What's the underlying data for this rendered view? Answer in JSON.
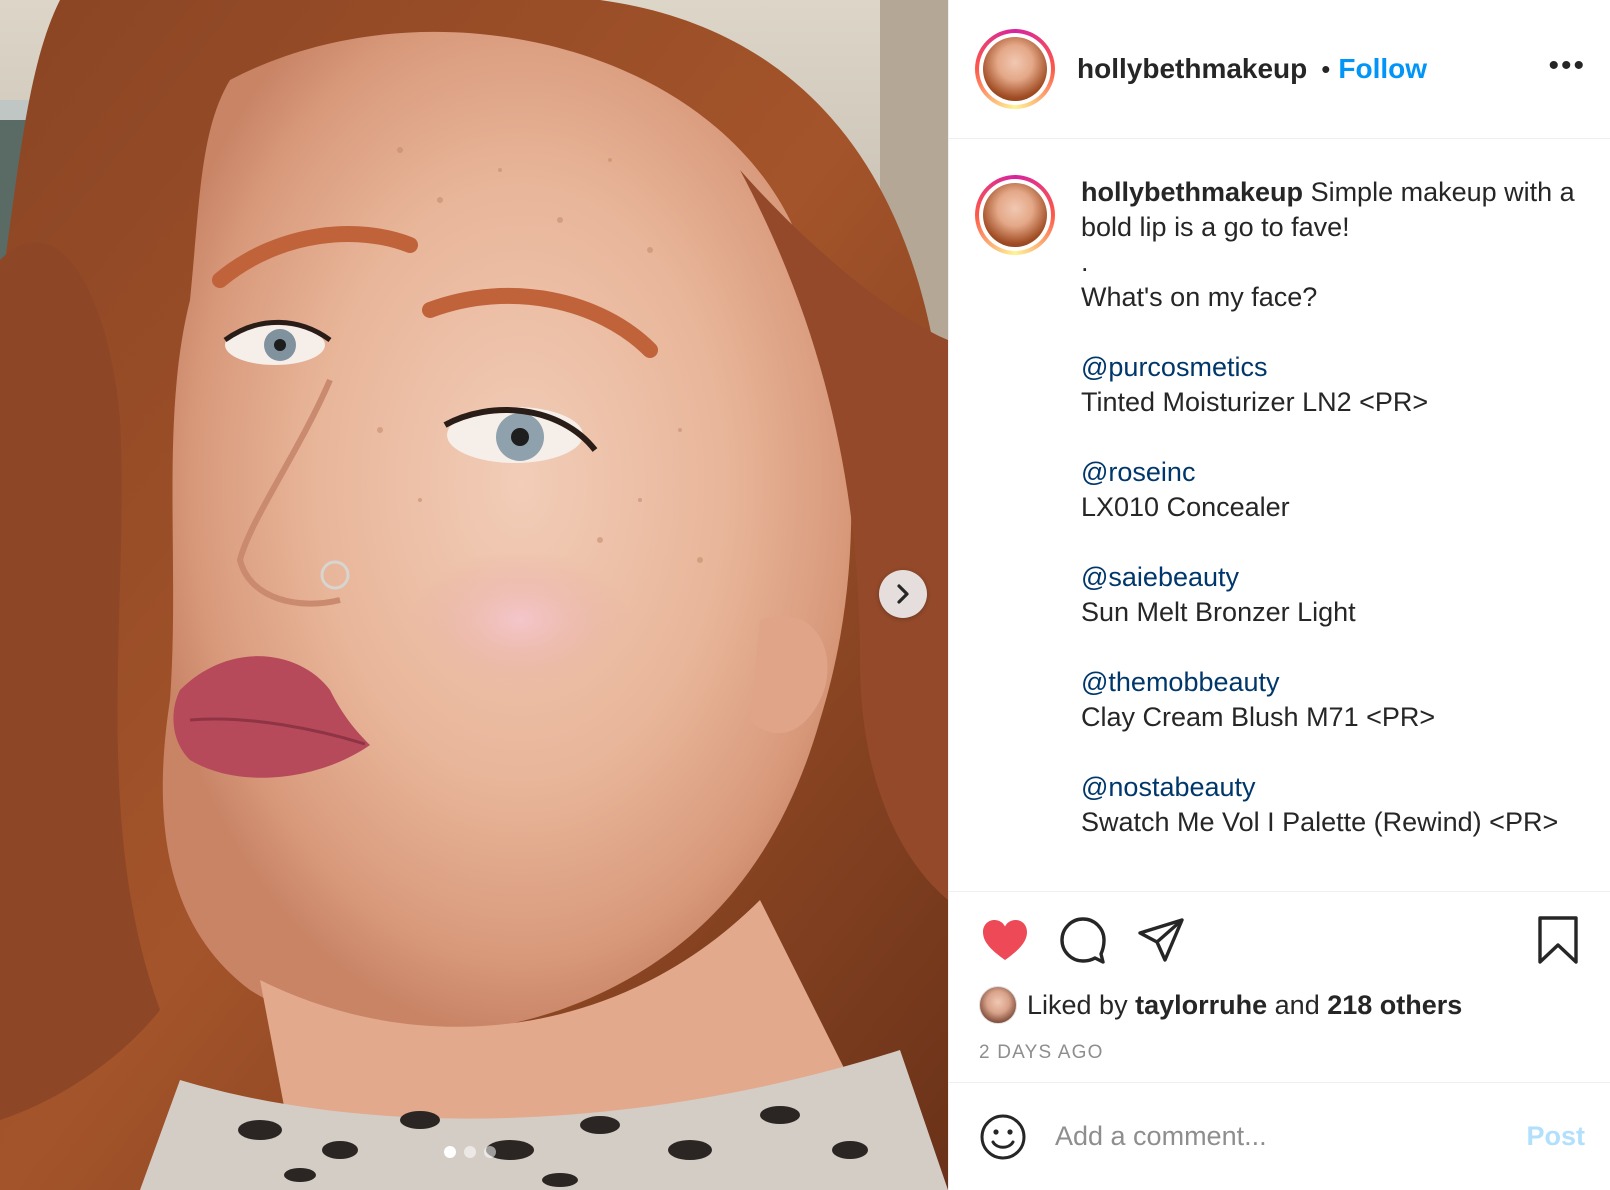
{
  "post": {
    "media": {
      "slide_count": 3,
      "active_slide": 1,
      "next_icon": "chevron-right-icon"
    },
    "header": {
      "username": "hollybethmakeup",
      "separator": "•",
      "follow_label": "Follow",
      "more_label": "•••"
    },
    "caption": {
      "username": "hollybethmakeup",
      "text": "Simple makeup with a bold lip is a go to fave!",
      "dot": ".",
      "question": "What's on my face?",
      "products": [
        {
          "mention": "@purcosmetics",
          "item": "Tinted Moisturizer LN2 <PR>"
        },
        {
          "mention": "@roseinc",
          "item": "LX010 Concealer"
        },
        {
          "mention": "@saiebeauty",
          "item": "Sun Melt Bronzer Light"
        },
        {
          "mention": "@themobbeauty",
          "item": "Clay Cream Blush M71 <PR>"
        },
        {
          "mention": "@nostabeauty",
          "item": "Swatch Me Vol I Palette (Rewind) <PR>"
        }
      ]
    },
    "actions": {
      "liked": true,
      "like_color": "#ed4956",
      "likes_prefix": "Liked by",
      "liked_by_user": "taylorruhe",
      "likes_and": "and",
      "likes_others": "218 others",
      "timestamp": "2 DAYS AGO"
    },
    "comment": {
      "placeholder": "Add a comment...",
      "post_label": "Post"
    },
    "colors": {
      "follow": "#0095f6",
      "mention": "#00376b",
      "post_disabled": "#b2dffc"
    }
  }
}
